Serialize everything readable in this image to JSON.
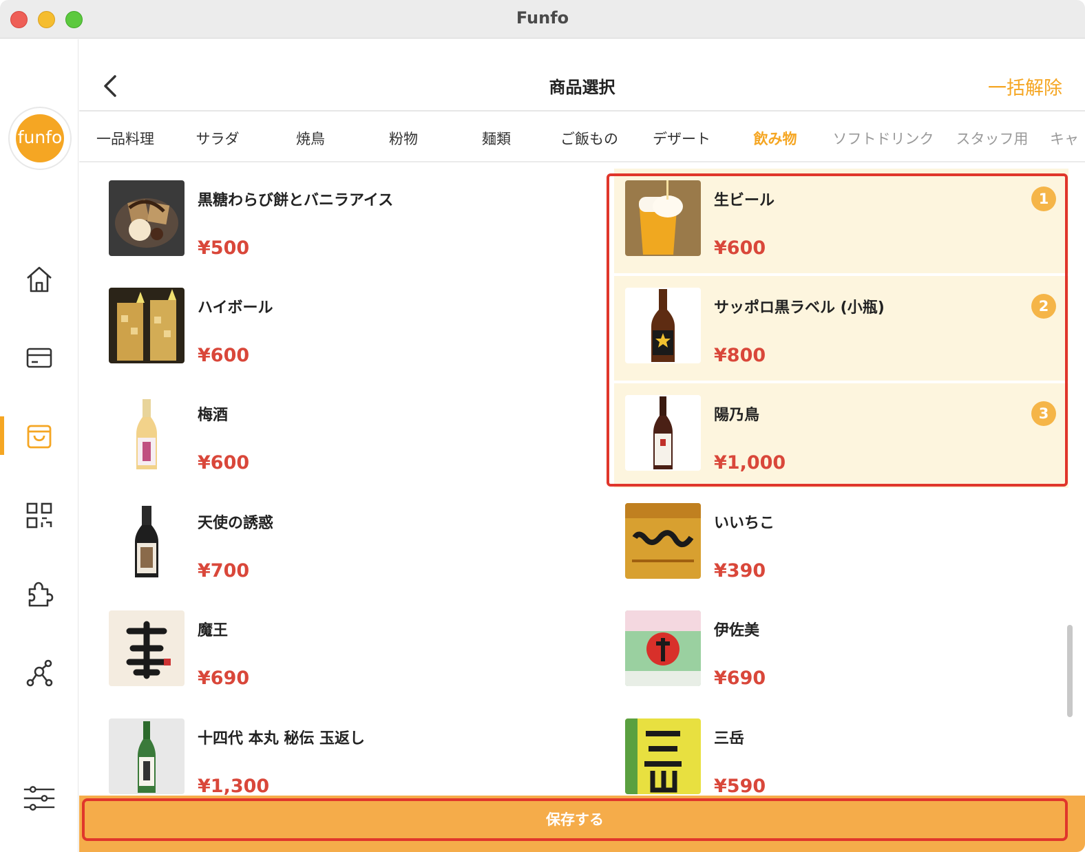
{
  "window": {
    "title": "Funfo"
  },
  "sidebar": {
    "logo_text": "funfo",
    "icons": [
      "home-icon",
      "card-icon",
      "shopping-bag-icon",
      "qr-code-icon",
      "puzzle-icon",
      "network-icon",
      "settings-sliders-icon"
    ],
    "active": "shopping-bag-icon"
  },
  "header": {
    "title": "商品選択",
    "bulk_clear_label": "一括解除"
  },
  "tabs": [
    {
      "label": "一品料理"
    },
    {
      "label": "サラダ"
    },
    {
      "label": "焼鳥"
    },
    {
      "label": "粉物"
    },
    {
      "label": "麺類"
    },
    {
      "label": "ご飯もの"
    },
    {
      "label": "デザート"
    },
    {
      "label": "飲み物",
      "active": true
    },
    {
      "label": "ソフトドリンク"
    },
    {
      "label": "スタッフ用"
    },
    {
      "label": "キャ"
    }
  ],
  "items_left": [
    {
      "name": "黒糖わらび餅とバニラアイス",
      "price": "¥500"
    },
    {
      "name": "ハイボール",
      "price": "¥600"
    },
    {
      "name": "梅酒",
      "price": "¥600"
    },
    {
      "name": "天使の誘惑",
      "price": "¥700"
    },
    {
      "name": "魔王",
      "price": "¥690"
    },
    {
      "name": "十四代 本丸 秘伝 玉返し",
      "price": "¥1,300"
    }
  ],
  "items_right": [
    {
      "name": "生ビール",
      "price": "¥600",
      "selected": true,
      "badge": "1"
    },
    {
      "name": "サッポロ黒ラベル (小瓶)",
      "price": "¥800",
      "selected": true,
      "badge": "2"
    },
    {
      "name": "陽乃鳥",
      "price": "¥1,000",
      "selected": true,
      "badge": "3"
    },
    {
      "name": "いいちこ",
      "price": "¥390"
    },
    {
      "name": "伊佐美",
      "price": "¥690"
    },
    {
      "name": "三岳",
      "price": "¥590"
    }
  ],
  "save_label": "保存する",
  "colors": {
    "accent": "#f5a623",
    "price": "#d9473a",
    "selected_bg": "#fdf5de",
    "highlight": "#e0362b"
  }
}
